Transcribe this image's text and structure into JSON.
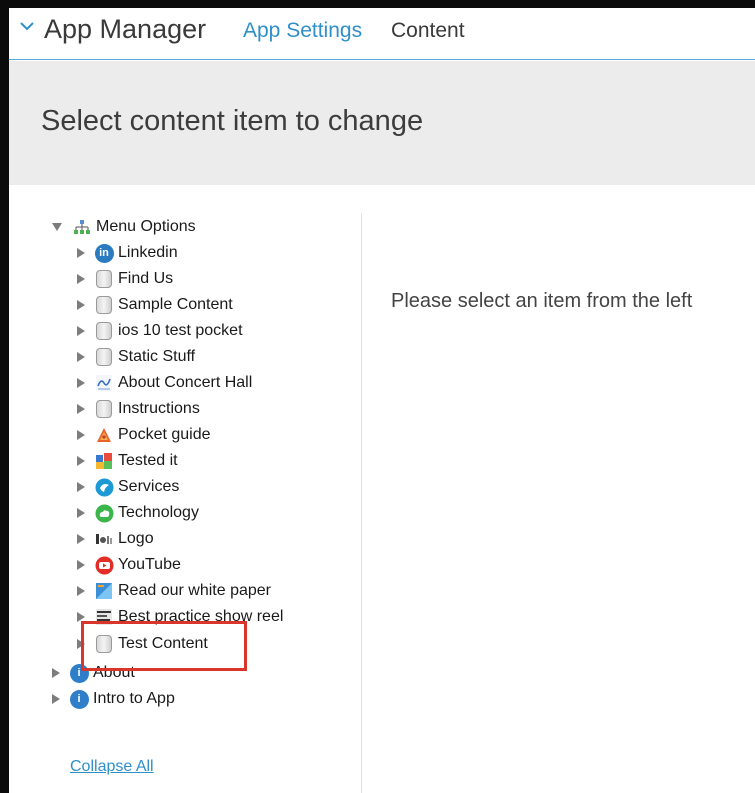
{
  "header": {
    "app_title": "App Manager",
    "nav_app_settings": "App Settings",
    "nav_content": "Content"
  },
  "page": {
    "title": "Select content item to change",
    "placeholder": "Please select an item from the left"
  },
  "tree": {
    "root": {
      "label": "Menu Options",
      "icon": "sitemap-icon"
    },
    "children": [
      {
        "label": "Linkedin",
        "icon": "linkedin-icon"
      },
      {
        "label": "Find Us",
        "icon": "page-icon"
      },
      {
        "label": "Sample Content",
        "icon": "page-icon"
      },
      {
        "label": "ios 10 test pocket",
        "icon": "page-icon"
      },
      {
        "label": "Static Stuff",
        "icon": "page-icon"
      },
      {
        "label": "About Concert Hall",
        "icon": "concert-hall-icon"
      },
      {
        "label": "Instructions",
        "icon": "page-icon"
      },
      {
        "label": "Pocket guide",
        "icon": "pocket-guide-icon"
      },
      {
        "label": "Tested it",
        "icon": "tested-icon"
      },
      {
        "label": "Services",
        "icon": "services-icon"
      },
      {
        "label": "Technology",
        "icon": "cloud-icon"
      },
      {
        "label": "Logo",
        "icon": "logo-icon"
      },
      {
        "label": "YouTube",
        "icon": "youtube-icon"
      },
      {
        "label": "Read our white paper",
        "icon": "white-paper-icon"
      },
      {
        "label": "Best practice show reel",
        "icon": "show-reel-icon"
      },
      {
        "label": "Test Content",
        "icon": "page-icon"
      }
    ],
    "siblings": [
      {
        "label": "About",
        "icon": "info-icon"
      },
      {
        "label": "Intro to App",
        "icon": "info-icon"
      }
    ]
  },
  "footer": {
    "collapse_all": "Collapse All"
  },
  "colors": {
    "link": "#2f8fc9",
    "highlight": "#d9362b",
    "header_band": "#ececec"
  }
}
